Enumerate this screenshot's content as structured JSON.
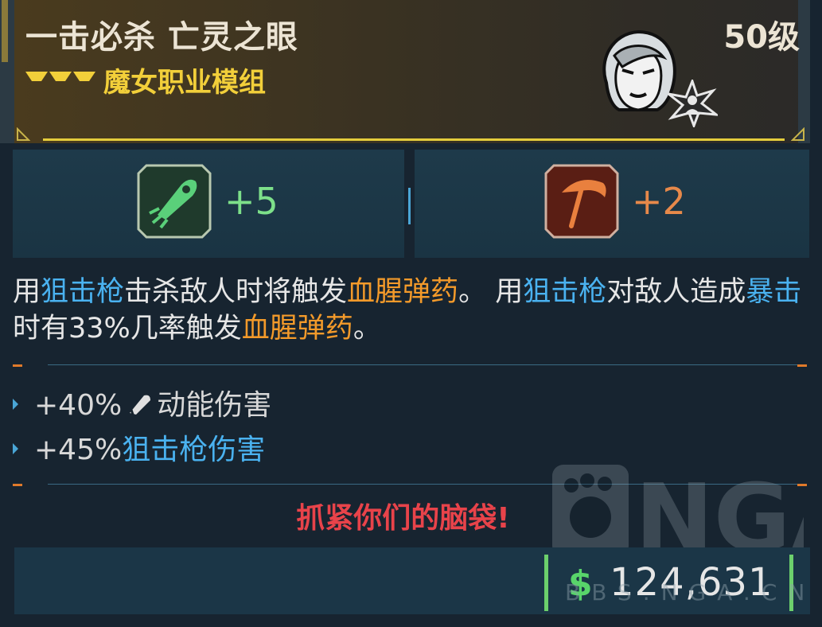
{
  "header": {
    "title": "一击必杀 亡灵之眼",
    "level": "50级",
    "subtitle": "魔女职业模组",
    "portrait_icon": "siren-portrait-icon",
    "class_badge_icon": "class-star-icon"
  },
  "stats": [
    {
      "icon": "sniper-rocket-icon",
      "value": "+5",
      "color": "#7de08a"
    },
    {
      "icon": "scythe-icon",
      "value": "+2",
      "color": "#e7894a"
    }
  ],
  "description": {
    "p1": "用",
    "k1": "狙击枪",
    "p2": "击杀敌人时将触发",
    "k2": "血腥弹药",
    "p3": "。 用",
    "k3": "狙击枪",
    "p4": "对敌人造成",
    "k4": "暴击",
    "p5": "时有33%几率触发",
    "k5": "血腥弹药",
    "p6": "。"
  },
  "bonuses": [
    {
      "pre": "+40%",
      "icon": "kinetic-damage-icon",
      "text": "动能伤害"
    },
    {
      "pre": "+45%",
      "kw": "狙击枪伤害"
    }
  ],
  "flavor": "抓紧你们的脑袋!",
  "price": {
    "currency_symbol": "$",
    "amount": "124,631"
  },
  "watermark": {
    "logo_text": "NGA",
    "url": "BBS.NGA.CN"
  },
  "colors": {
    "accent_yellow": "#e4cc3c",
    "keyword_blue": "#4ab2f0",
    "keyword_orange": "#f39a2a",
    "flavor_red": "#e8434a",
    "money_green": "#58d46a"
  }
}
